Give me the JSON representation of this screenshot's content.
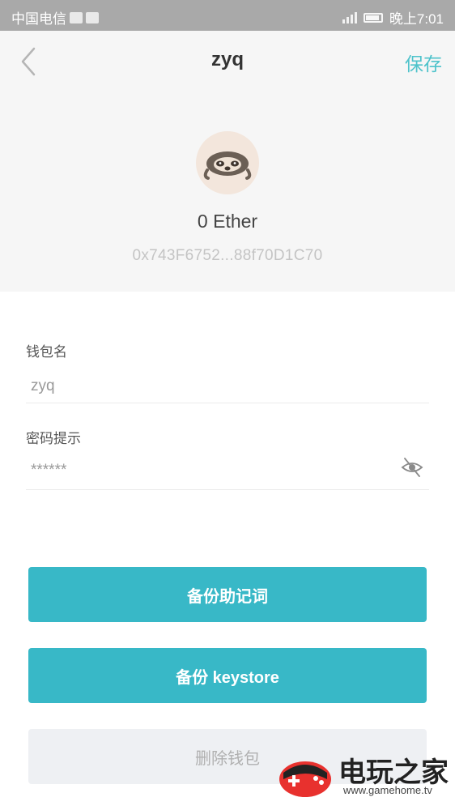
{
  "status_bar": {
    "carrier": "中国电信",
    "time": "晚上7:01"
  },
  "header": {
    "title": "zyq",
    "save_label": "保存",
    "balance": "0 Ether",
    "address": "0x743F6752...88f70D1C70"
  },
  "form": {
    "wallet_name_label": "钱包名",
    "wallet_name_value": "zyq",
    "password_hint_label": "密码提示",
    "password_hint_value": "******"
  },
  "buttons": {
    "backup_mnemonic": "备份助记词",
    "backup_keystore": "备份 keystore",
    "delete_wallet": "删除钱包"
  },
  "watermark": {
    "text": "电玩之家",
    "url": "www.gamehome.tv"
  },
  "colors": {
    "accent": "#38b8c7",
    "save_text": "#4ec3cb",
    "header_bg": "#f6f6f6",
    "status_bar_bg": "#a9a9a9"
  }
}
